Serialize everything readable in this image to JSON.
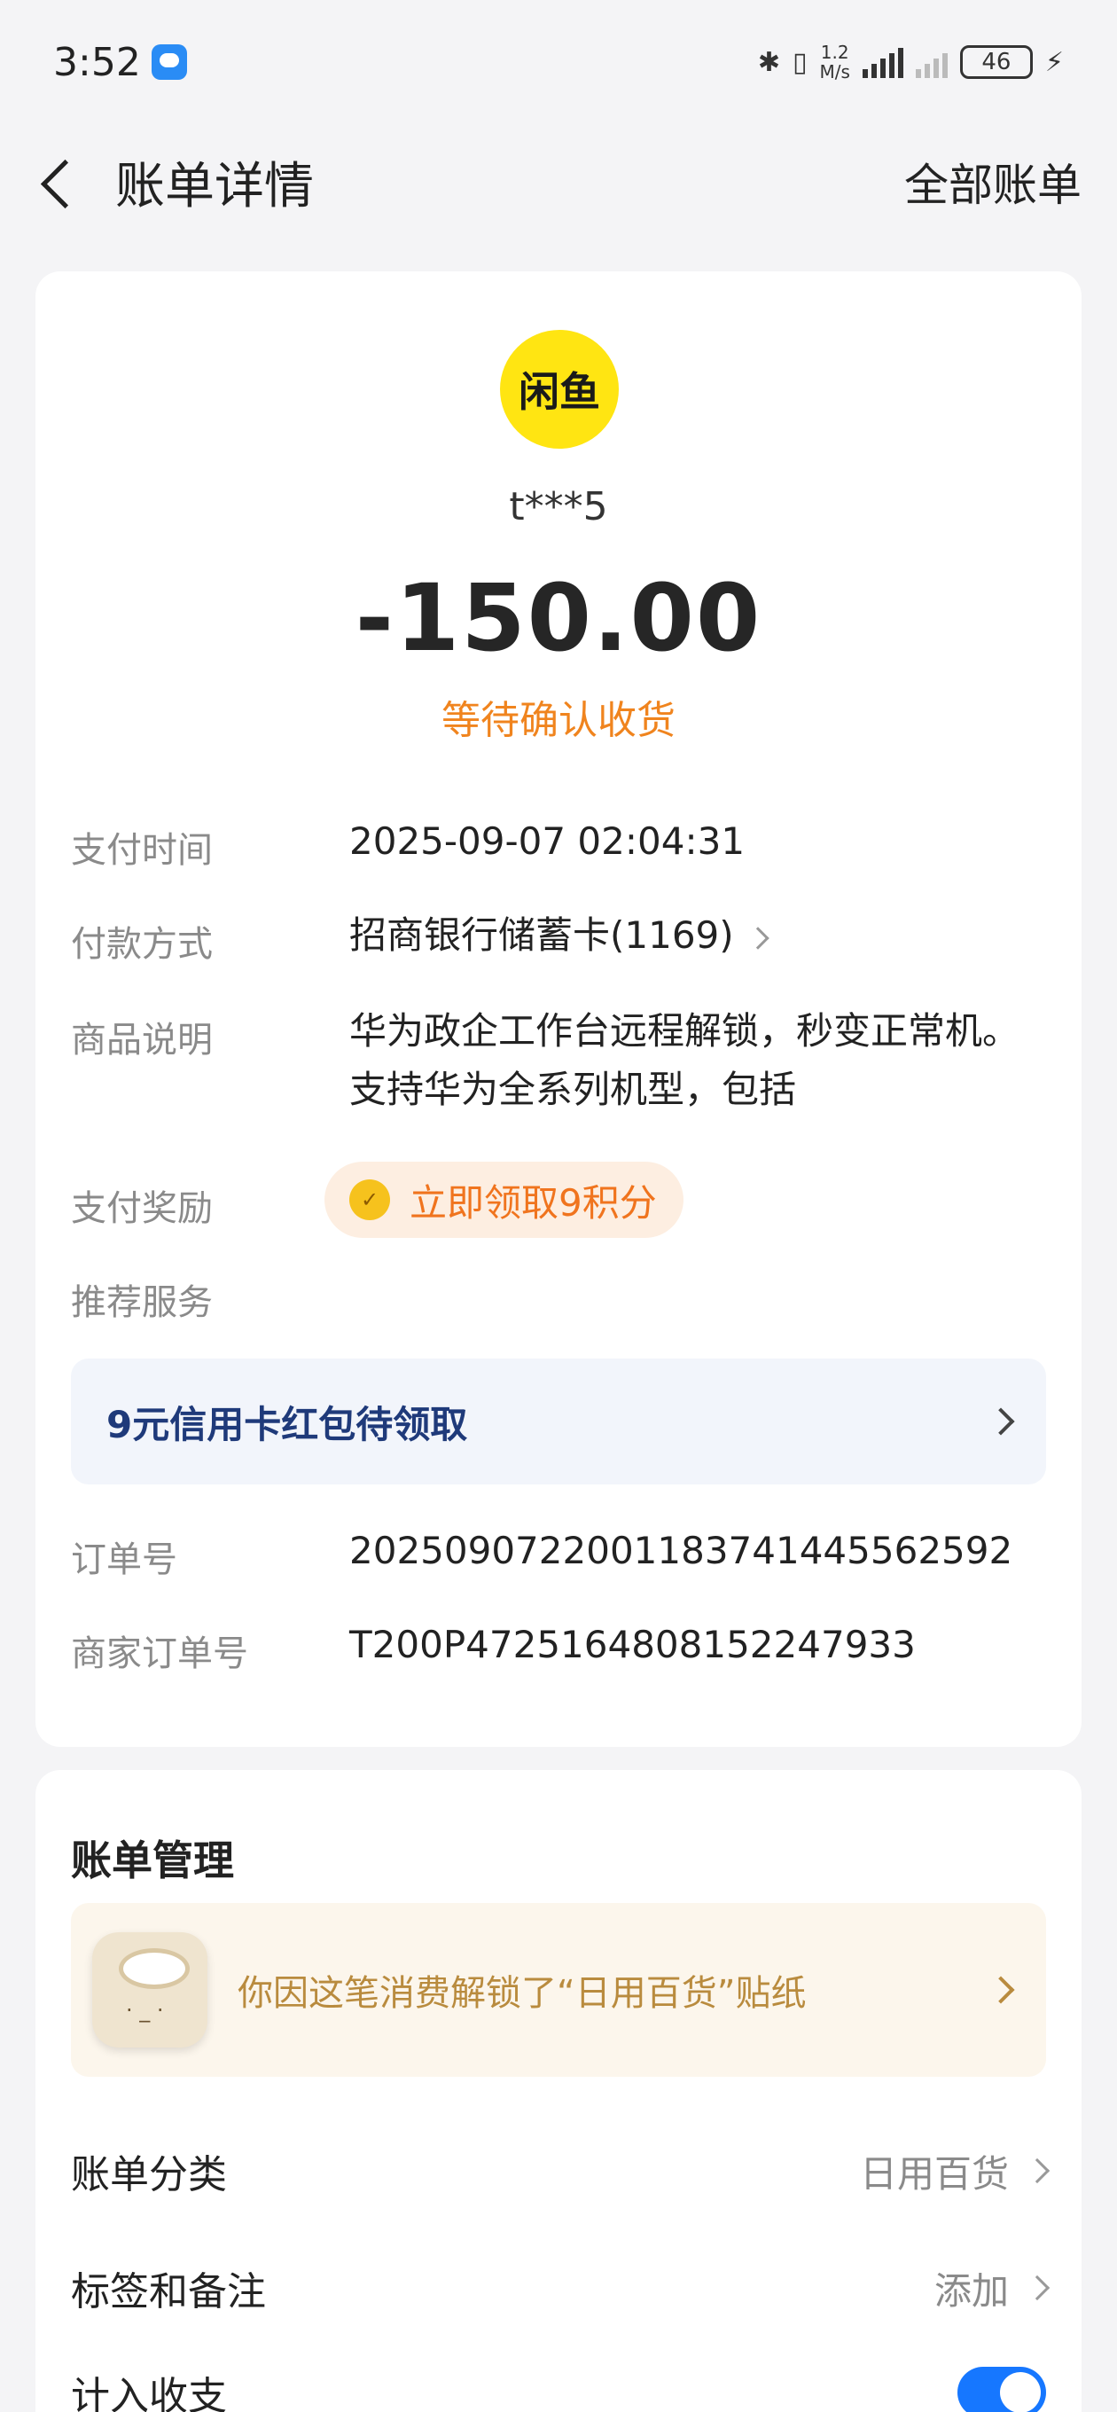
{
  "status_bar": {
    "time": "3:52",
    "speed_value": "1.2",
    "speed_unit": "M/s",
    "battery": "46"
  },
  "nav": {
    "title": "账单详情",
    "right_link": "全部账单"
  },
  "bill": {
    "merchant_logo_text": "闲鱼",
    "merchant_name": "t***5",
    "amount": "-150.00",
    "status": "等待确认收货",
    "details": {
      "pay_time_label": "支付时间",
      "pay_time_value": "2025-09-07 02:04:31",
      "pay_method_label": "付款方式",
      "pay_method_value": "招商银行储蓄卡(1169)",
      "goods_label": "商品说明",
      "goods_line1": "华为政企工作台远程解锁，秒变正常机。",
      "goods_line2": "支持华为全系列机型，包括",
      "reward_label": "支付奖励",
      "reward_text": "立即领取9积分",
      "recommend_label": "推荐服务",
      "promo_text": "9元信用卡红包待领取",
      "order_no_label": "订单号",
      "order_no_value": "2025090722001183741445562592",
      "merchant_order_label": "商家订单号",
      "merchant_order_value": "T200P4725164808152247933"
    }
  },
  "manage": {
    "title": "账单管理",
    "sticker_text": "你因这笔消费解锁了“日用百货”贴纸",
    "category_label": "账单分类",
    "category_value": "日用百货",
    "tags_label": "标签和备注",
    "tags_value": "添加",
    "include_label": "计入收支",
    "include_on": true
  },
  "colors": {
    "accent_orange": "#f0841e",
    "toggle_blue": "#1677ff",
    "logo_yellow": "#ffe512"
  }
}
